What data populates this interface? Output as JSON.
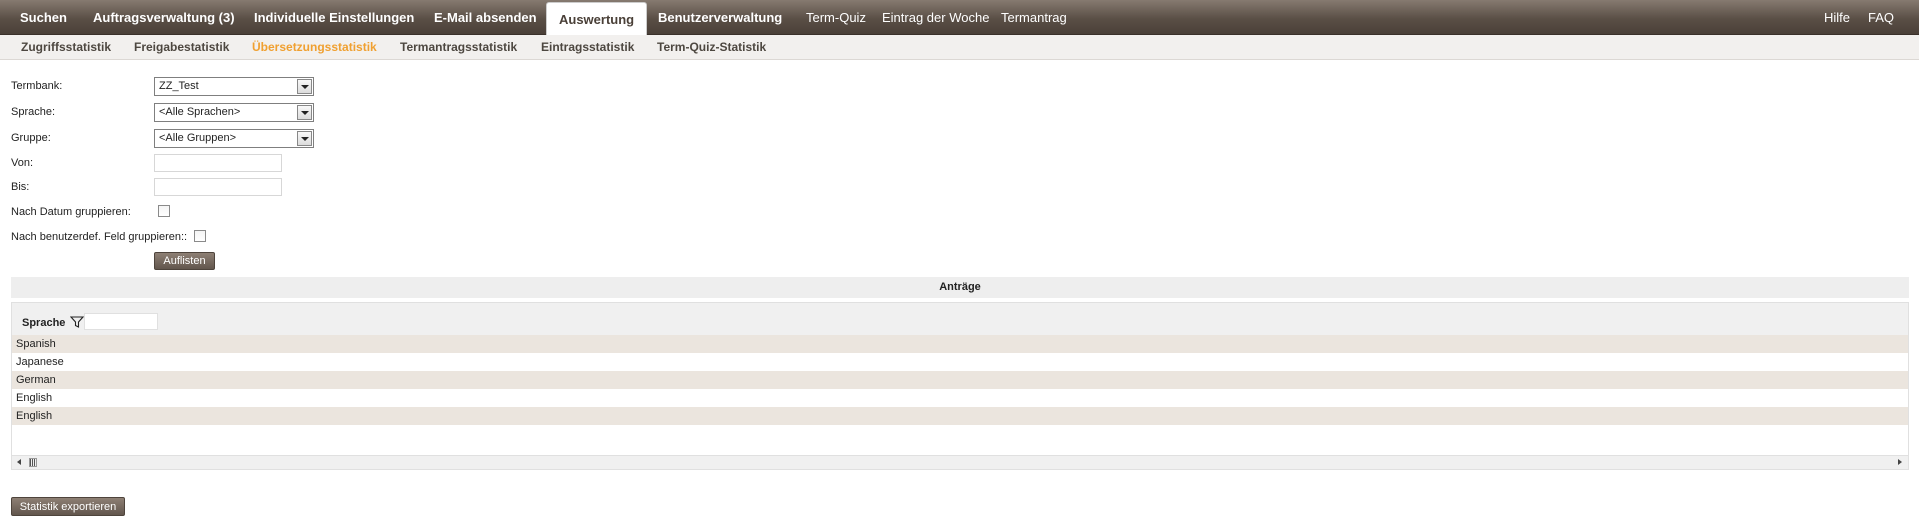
{
  "topnav": {
    "items": [
      {
        "label": "Suchen"
      },
      {
        "label": "Auftragsverwaltung (3)"
      },
      {
        "label": "Individuelle Einstellungen"
      },
      {
        "label": "E-Mail absenden"
      },
      {
        "label": "Auswertung",
        "active": true
      },
      {
        "label": "Benutzerverwaltung"
      },
      {
        "label": "Term-Quiz"
      },
      {
        "label": "Eintrag der Woche"
      },
      {
        "label": "Termantrag"
      }
    ],
    "help_label": "Hilfe",
    "faq_label": "FAQ"
  },
  "subnav": {
    "items": [
      {
        "label": "Zugriffsstatistik"
      },
      {
        "label": "Freigabestatistik"
      },
      {
        "label": "Übersetzungsstatistik",
        "active": true
      },
      {
        "label": "Termantragsstatistik"
      },
      {
        "label": "Eintragsstatistik"
      },
      {
        "label": "Term-Quiz-Statistik"
      }
    ],
    "active_color": "#f0a030"
  },
  "form": {
    "termbank_label": "Termbank:",
    "termbank_value": "ZZ_Test",
    "sprache_label": "Sprache:",
    "sprache_value": "<Alle Sprachen>",
    "gruppe_label": "Gruppe:",
    "gruppe_value": "<Alle Gruppen>",
    "von_label": "Von:",
    "von_value": "",
    "bis_label": "Bis:",
    "bis_value": "",
    "datum_group_label": "Nach Datum gruppieren:",
    "datum_group_checked": false,
    "feld_group_label": "Nach benutzerdef. Feld gruppieren::",
    "feld_group_checked": false,
    "list_button": "Auflisten"
  },
  "results": {
    "header": "Anträge",
    "column": "Sprache",
    "filter_icon": "filter-icon",
    "filter_value": "",
    "rows": [
      "Spanish",
      "Japanese",
      "German",
      "English",
      "English"
    ]
  },
  "export_button": "Statistik exportieren",
  "colors": {
    "nav_dark": "#4a4038",
    "button": "#6b5f55",
    "row_alt": "#ebe5de"
  }
}
